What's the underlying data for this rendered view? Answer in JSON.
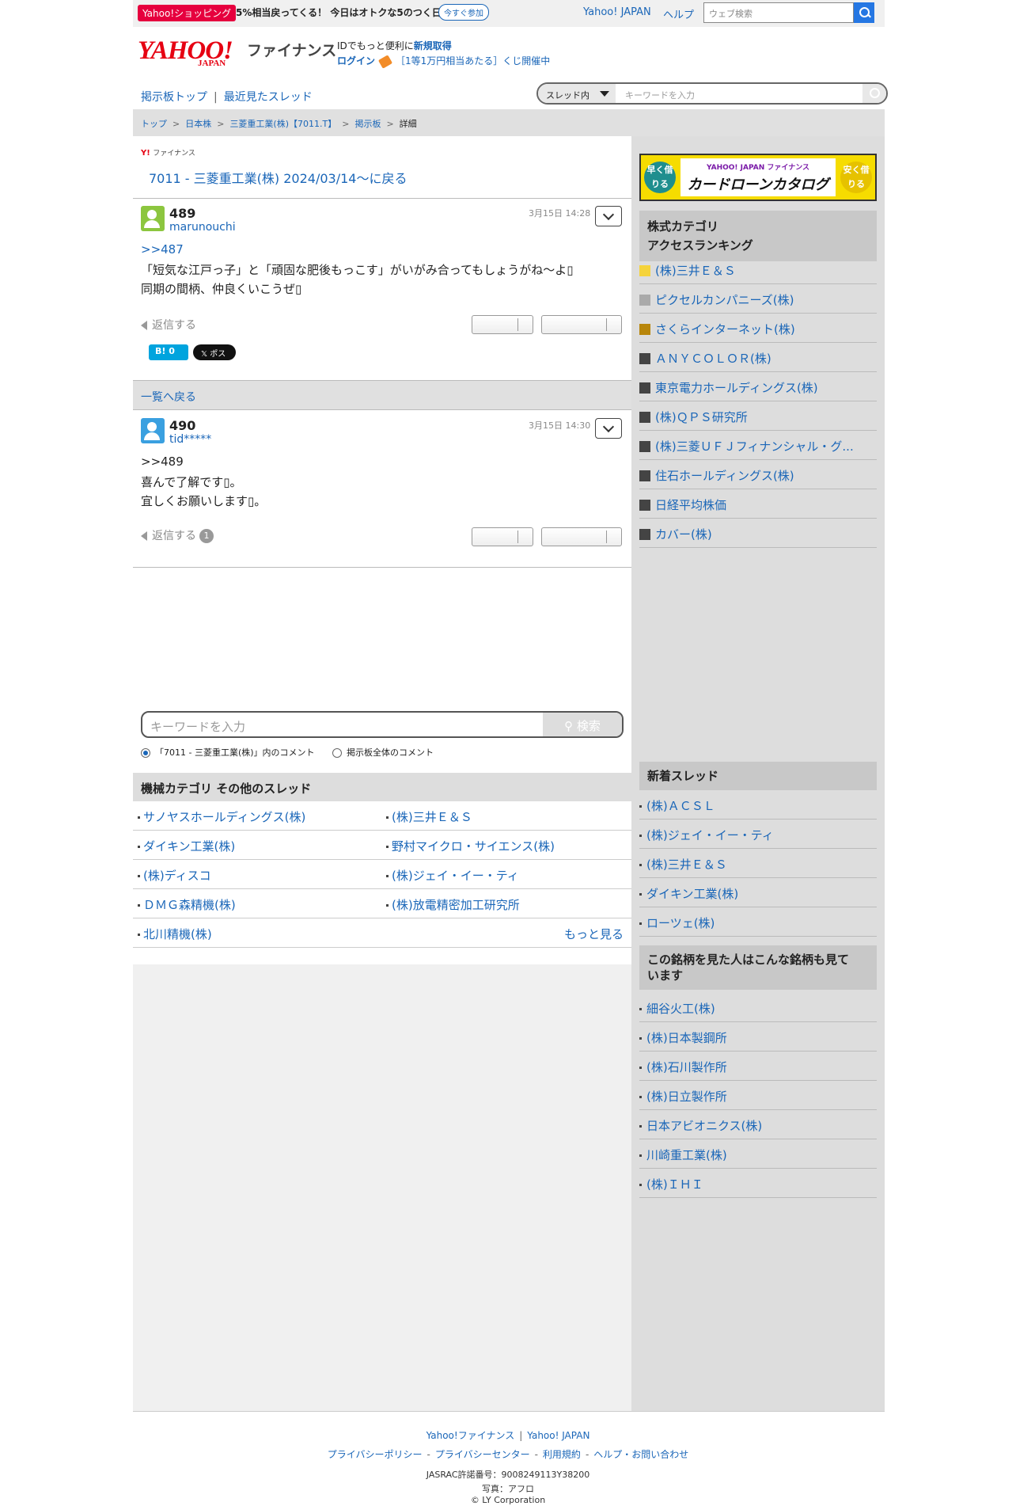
{
  "promo": {
    "shop_label": "Yahoo!ショッピング",
    "message": "5%相当戻ってくる！ 今日はオトクな5のつく日",
    "join_label": "今すぐ参加",
    "yahoo_japan": "Yahoo! JAPAN",
    "help": "ヘルプ",
    "web_search_placeholder": "ウェブ検索"
  },
  "header": {
    "logo": "YAHOO!",
    "logo_sub": "JAPAN",
    "service": "ファイナンス",
    "id_text": "IDでもっと便利に",
    "signup": "新規取得",
    "login": "ログイン",
    "lottery": "［1等1万円相当あたる］くじ開催中"
  },
  "subnav": {
    "board_top": "掲示板トップ",
    "sep": "|",
    "recent": "最近見たスレッド"
  },
  "thread_search": {
    "scope": "スレッド内",
    "placeholder": "キーワードを入力"
  },
  "breadcrumb": {
    "items": [
      "トップ",
      "日本株",
      "三菱重工業(株)【7011.T】",
      "掲示板",
      "詳細"
    ],
    "sep": ">"
  },
  "main": {
    "mini_logo": "Y!",
    "mini_logo_sub": "ファイナンス",
    "back_link": "7011 - 三菱重工業(株) 2024/03/14〜に戻る",
    "list_back": "一覧へ戻る",
    "posts": [
      {
        "number": "489",
        "user": "marunouchi",
        "date": "3月15日 14:28",
        "anchor": ">>487",
        "lines": [
          "「短気な江戸っ子」と「頑固な肥後もっこす」がいがみ合ってもしょうがね〜よ▯",
          "同期の間柄、仲良くいこうぜ▯"
        ],
        "reply": "返信する",
        "avatar_color": "#8cc63f"
      },
      {
        "number": "490",
        "user": "tid*****",
        "date": "3月15日 14:30",
        "anchor": ">>489",
        "lines": [
          "喜んで了解です▯。",
          "宜しくお願いします▯。"
        ],
        "reply": "返信する",
        "reply_count": "1",
        "avatar_color": "#3aa0e0"
      }
    ],
    "hatebu": "B! 0",
    "x_label": "𝕏 ポスト",
    "keyword_placeholder": "キーワードを入力",
    "keyword_button": "検索",
    "radio_thread": "「7011 - 三菱重工業(株)」内のコメント",
    "radio_all": "掲示板全体のコメント",
    "other_heading": "機械カテゴリ  その他のスレッド",
    "other_threads": [
      [
        "サノヤスホールディングス(株)",
        "(株)三井Ｅ＆Ｓ"
      ],
      [
        "ダイキン工業(株)",
        "野村マイクロ・サイエンス(株)"
      ],
      [
        "(株)ディスコ",
        "(株)ジェイ・イー・ティ"
      ],
      [
        "ＤＭＧ森精機(株)",
        "(株)放電精密加工研究所"
      ]
    ],
    "last_thread": "北川精機(株)",
    "more": "もっと見る"
  },
  "side": {
    "banner_left": "早く借りる",
    "banner_brand": "YAHOO! JAPAN ファイナンス",
    "banner_title": "カードローンカタログ",
    "banner_right": "安く借りる",
    "ranking_heading_1": "株式カテゴリ",
    "ranking_heading_2": "アクセスランキング",
    "ranking": [
      {
        "name": "(株)三井Ｅ＆Ｓ",
        "color": "#f5d33b"
      },
      {
        "name": "ピクセルカンパニーズ(株)",
        "color": "#aaaaaa"
      },
      {
        "name": "さくらインターネット(株)",
        "color": "#b8860b"
      },
      {
        "name": "ＡＮＹＣＯＬＯＲ(株)",
        "color": "#444444"
      },
      {
        "name": "東京電力ホールディングス(株)",
        "color": "#444444"
      },
      {
        "name": "(株)ＱＰＳ研究所",
        "color": "#444444"
      },
      {
        "name": "(株)三菱ＵＦＪフィナンシャル・グ...",
        "color": "#444444"
      },
      {
        "name": "住石ホールディングス(株)",
        "color": "#444444"
      },
      {
        "name": "日経平均株価",
        "color": "#444444"
      },
      {
        "name": "カバー(株)",
        "color": "#444444"
      }
    ],
    "new_heading": "新着スレッド",
    "new_threads": [
      "(株)ＡＣＳＬ",
      "(株)ジェイ・イー・ティ",
      "(株)三井Ｅ＆Ｓ",
      "ダイキン工業(株)",
      "ローツェ(株)"
    ],
    "also_heading_1": "この銘柄を見た人はこんな銘柄も見て",
    "also_heading_2": "います",
    "also_viewed": [
      "細谷火工(株)",
      "(株)日本製鋼所",
      "(株)石川製作所",
      "(株)日立製作所",
      "日本アビオニクス(株)",
      "川崎重工業(株)",
      "(株)ＩＨＩ"
    ]
  },
  "footer": {
    "finance": "Yahoo!ファイナンス",
    "yj": "Yahoo! JAPAN",
    "privacy_policy": "プライバシーポリシー",
    "privacy_center": "プライバシーセンター",
    "terms": "利用規約",
    "help": "ヘルプ・お問い合わせ",
    "jasrac": "JASRAC許諾番号：9008249113Y38200",
    "photo": "写真：アフロ",
    "copyright": "© LY Corporation"
  }
}
